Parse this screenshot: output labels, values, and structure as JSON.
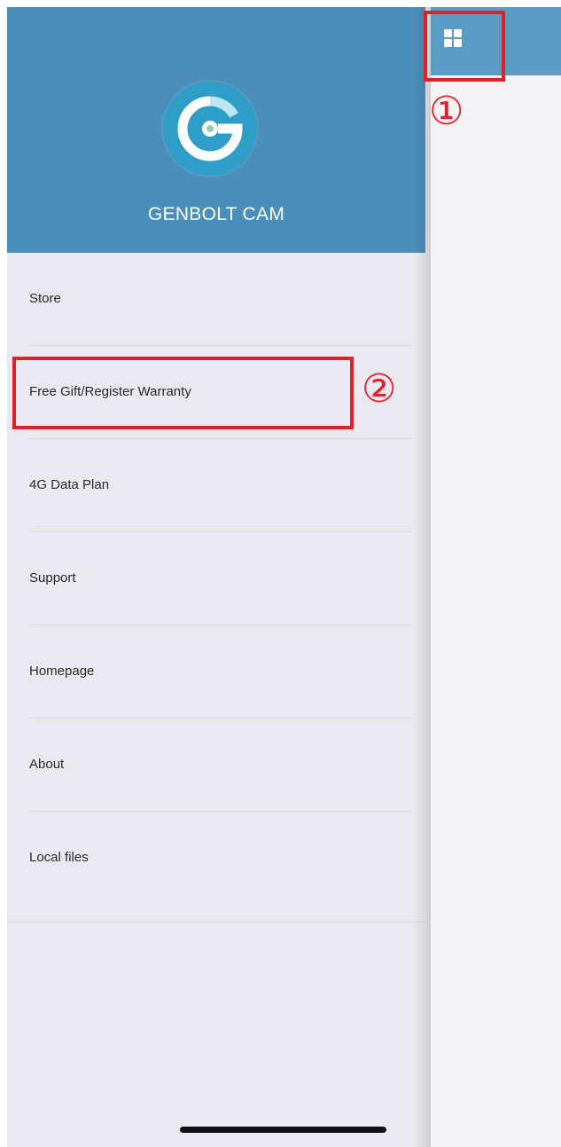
{
  "app": {
    "name": "GENBOLT CAM"
  },
  "menu": {
    "items": [
      {
        "label": "Store"
      },
      {
        "label": "Free Gift/Register Warranty"
      },
      {
        "label": "4G Data Plan"
      },
      {
        "label": "Support"
      },
      {
        "label": "Homepage"
      },
      {
        "label": "About"
      },
      {
        "label": "Local files"
      }
    ]
  },
  "toolbar": {
    "menu_icon": "grid-icon"
  },
  "annotations": {
    "one": "①",
    "two": "②"
  },
  "colors": {
    "header": "#4a8fba",
    "topbar": "#5b9cc4",
    "logo": "#2e9ec9",
    "annotation": "#e2202a",
    "drawer_bg": "#e9e9ef"
  }
}
